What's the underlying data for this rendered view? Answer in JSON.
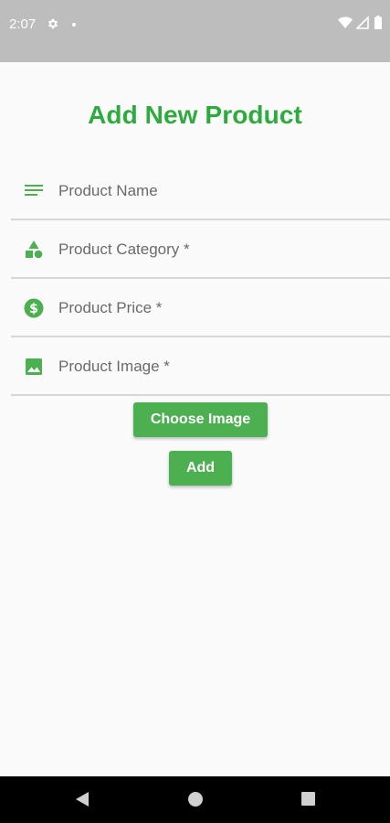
{
  "status_bar": {
    "time": "2:07",
    "icons": [
      "gear-icon",
      "dot-icon",
      "wifi-icon",
      "signal-icon",
      "battery-icon"
    ]
  },
  "page": {
    "title": "Add New Product"
  },
  "form": {
    "fields": [
      {
        "icon": "lines-icon",
        "placeholder": "Product Name",
        "value": ""
      },
      {
        "icon": "category-shapes-icon",
        "placeholder": "Product Category *",
        "value": ""
      },
      {
        "icon": "dollar-icon",
        "placeholder": "Product Price *",
        "value": ""
      },
      {
        "icon": "image-icon",
        "placeholder": "Product Image *",
        "value": ""
      }
    ],
    "choose_image_label": "Choose Image",
    "add_label": "Add"
  },
  "nav_bar": {
    "icons": [
      "back-icon",
      "home-icon",
      "recents-icon"
    ]
  },
  "colors": {
    "accent": "#2eaa3e",
    "button": "#4caf50",
    "status_bar": "#bdbdbd",
    "background": "#fafafa"
  }
}
